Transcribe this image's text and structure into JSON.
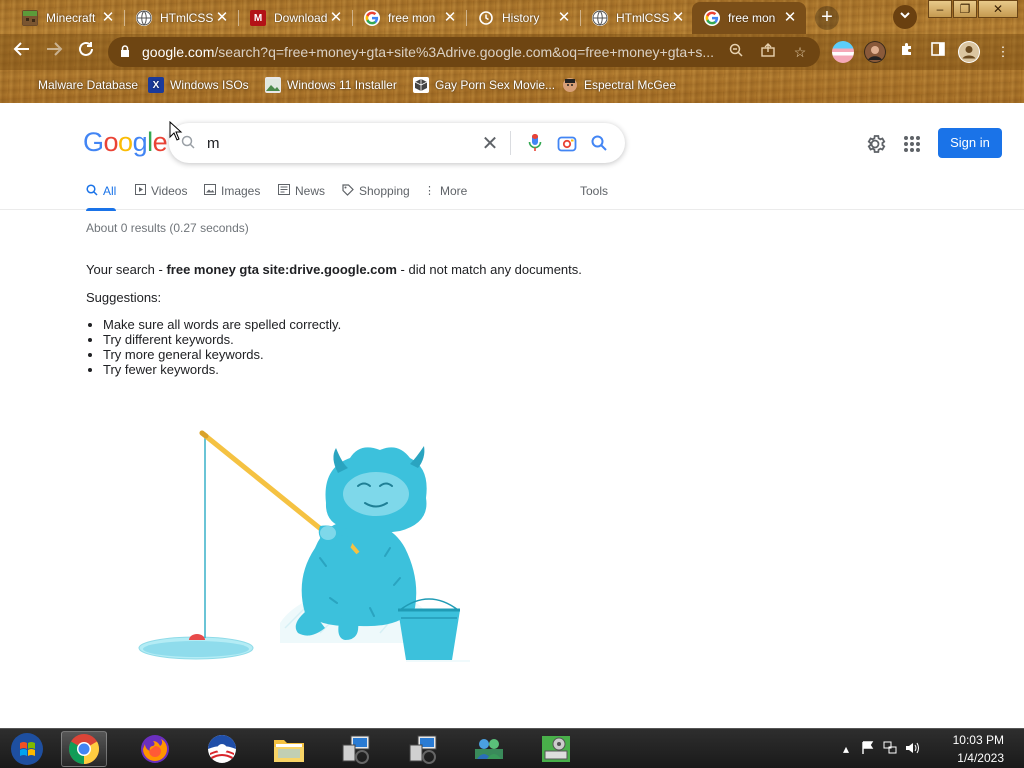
{
  "tabs": [
    {
      "title": "Minecraft",
      "favicon": "minecraft-icon"
    },
    {
      "title": "HTmlCSS",
      "favicon": "globe-icon"
    },
    {
      "title": "Download",
      "favicon": "m-icon"
    },
    {
      "title": "free mon",
      "favicon": "google-icon"
    },
    {
      "title": "History",
      "favicon": "history-icon"
    },
    {
      "title": "HTmlCSS",
      "favicon": "globe-icon"
    },
    {
      "title": "free mon",
      "favicon": "google-icon",
      "active": true
    }
  ],
  "toolbar": {
    "url_host": "google.com",
    "url_rest": "/search?q=free+money+gta+site%3Adrive.google.com&oq=free+money+gta+s..."
  },
  "bookmarks": [
    {
      "label": "Malware Database"
    },
    {
      "label": "Windows ISOs"
    },
    {
      "label": "Windows 11 Installer"
    },
    {
      "label": "Gay Porn Sex Movie..."
    },
    {
      "label": "Espectral McGee"
    }
  ],
  "google": {
    "search_value": "m",
    "sign_in": "Sign in",
    "tabs": [
      {
        "label": "All",
        "active": true
      },
      {
        "label": "Videos"
      },
      {
        "label": "Images"
      },
      {
        "label": "News"
      },
      {
        "label": "Shopping"
      },
      {
        "label": "More"
      }
    ],
    "tools": "Tools",
    "result_stats": "About 0 results (0.27 seconds)",
    "no_match_prefix": "Your search - ",
    "no_match_query": "free money gta site:drive.google.com",
    "no_match_suffix": " - did not match any documents.",
    "suggestions_label": "Suggestions:",
    "suggestions": [
      "Make sure all words are spelled correctly.",
      "Try different keywords.",
      "Try more general keywords.",
      "Try fewer keywords."
    ]
  },
  "taskbar": {
    "time": "10:03 PM",
    "date": "1/4/2023"
  },
  "colors": {
    "accent": "#1a73e8",
    "chrome_wood": "#b3802f"
  }
}
